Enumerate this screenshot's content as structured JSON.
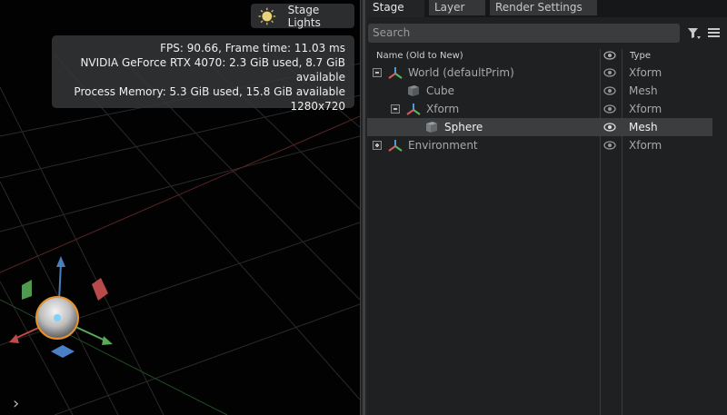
{
  "viewport": {
    "stage_lights_label": "Stage Lights",
    "stats": [
      "FPS: 90.66, Frame time: 11.03 ms",
      "NVIDIA GeForce RTX 4070: 2.3 GiB used, 8.7 GiB available",
      "Process Memory: 5.3 GiB used, 15.8 GiB available",
      "1280x720"
    ],
    "expand_glyph": "›"
  },
  "panel": {
    "tabs": [
      {
        "label": "Stage",
        "active": true
      },
      {
        "label": "Layer",
        "active": false
      },
      {
        "label": "Render Settings",
        "active": false
      }
    ],
    "search": {
      "placeholder": "Search",
      "value": ""
    },
    "columns": {
      "name": "Name (Old to New)",
      "type": "Type"
    },
    "rows": [
      {
        "name": "World (defaultPrim)",
        "type": "Xform",
        "icon": "xform-icon",
        "toggle": "collapse",
        "selected": false
      },
      {
        "name": "Cube",
        "type": "Mesh",
        "icon": "mesh-icon",
        "toggle": "none",
        "selected": false
      },
      {
        "name": "Xform",
        "type": "Xform",
        "icon": "xform-icon",
        "toggle": "collapse",
        "selected": false
      },
      {
        "name": "Sphere",
        "type": "Mesh",
        "icon": "mesh-icon",
        "toggle": "none",
        "selected": true
      },
      {
        "name": "Environment",
        "type": "Xform",
        "icon": "xform-icon",
        "toggle": "expand",
        "selected": false
      }
    ]
  },
  "colors": {
    "selection_orange": "#e8922a",
    "axis_y": "#4a7fc0",
    "axis_x": "#c04a4a",
    "axis_z": "#5aa85a"
  }
}
